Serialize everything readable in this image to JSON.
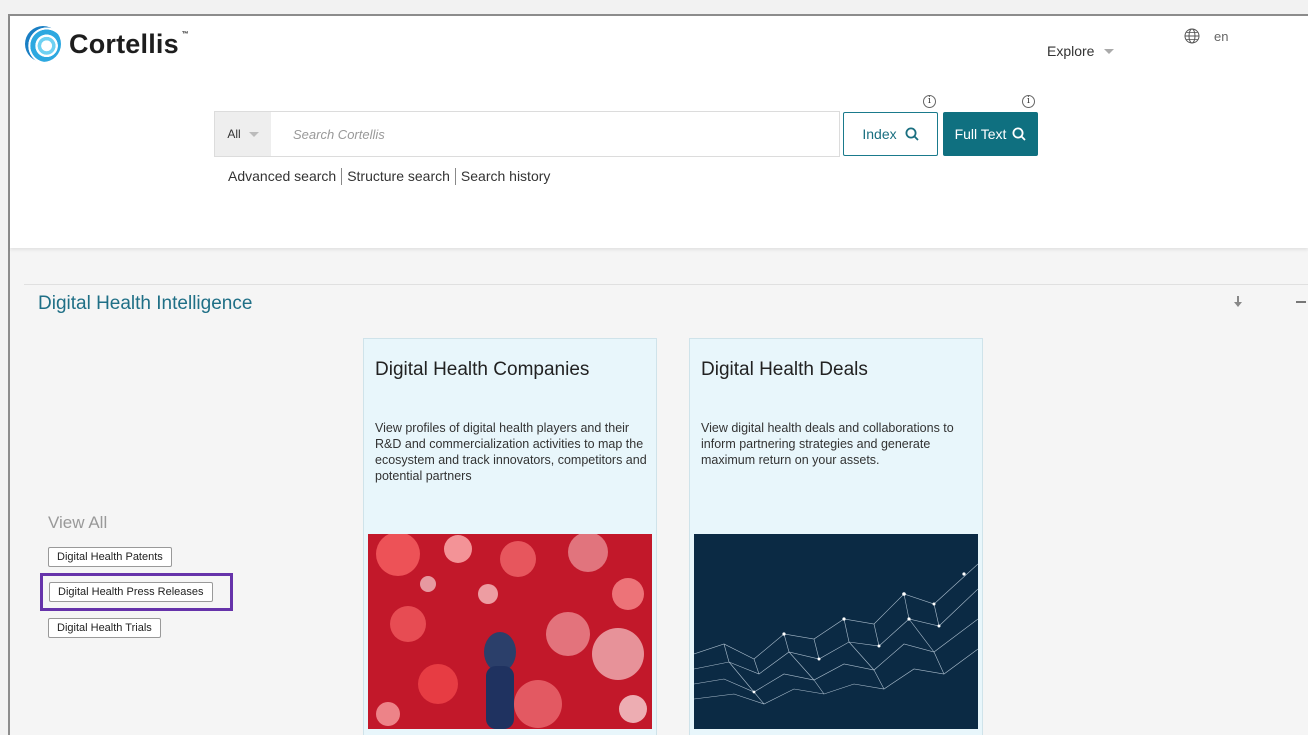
{
  "header": {
    "brand": "Cortellis",
    "trademark": "™",
    "explore_label": "Explore",
    "language": "en"
  },
  "search": {
    "scope_label": "All",
    "placeholder": "Search Cortellis",
    "value": "",
    "index_label": "Index",
    "full_text_label": "Full Text",
    "info_glyph": "i",
    "links": [
      "Advanced search",
      "Structure search",
      "Search history"
    ]
  },
  "section": {
    "title": "Digital Health Intelligence",
    "view_all_label": "View All",
    "tags": [
      "Digital Health Patents",
      "Digital Health Press Releases",
      "Digital Health Trials"
    ],
    "cards": [
      {
        "title": "Digital Health Companies",
        "description": "View profiles of digital health players and their R&D and commercialization activities to map the ecosystem and track innovators, competitors and potential partners"
      },
      {
        "title": "Digital Health Deals",
        "description": "View digital health deals and collaborations to inform partnering strategies and generate maximum return on your assets."
      }
    ]
  },
  "colors": {
    "accent": "#0f7080",
    "section_title": "#1f6f86",
    "card_bg": "#e8f6fb",
    "highlight": "#6633aa"
  }
}
